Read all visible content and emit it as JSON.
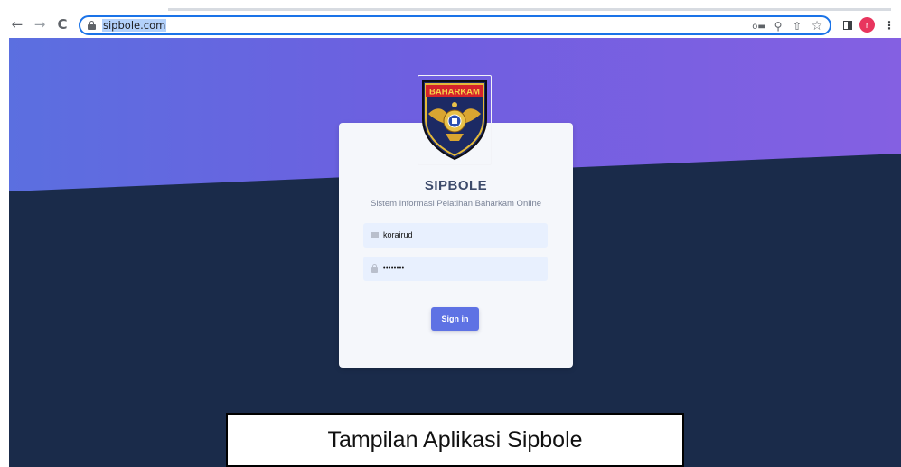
{
  "browser": {
    "back_icon": "←",
    "forward_icon": "→",
    "reload_icon": "C",
    "url": "sipbole.com",
    "key_icon": "o▬",
    "zoom_icon": "⚲",
    "share_icon": "⇧",
    "star_icon": "☆",
    "menu_icon": "⋮",
    "profile_initial": "r",
    "profile_color": "#e8355e",
    "omnibox_focus_color": "#1a73e8"
  },
  "page": {
    "logo_text": "BAHARKAM",
    "app_title": "SIPBOLE",
    "app_subtitle": "Sistem Informasi Pelatihan Baharkam Online",
    "username_value": "korairud",
    "password_value": "••••••••",
    "signin_label": "Sign in",
    "accent_color": "#5e72e4",
    "gradient_colors": [
      "#5b6fe0",
      "#8460e2"
    ],
    "dark_color": "#1a2b4a"
  },
  "caption": {
    "text": "Tampilan Aplikasi Sipbole"
  }
}
